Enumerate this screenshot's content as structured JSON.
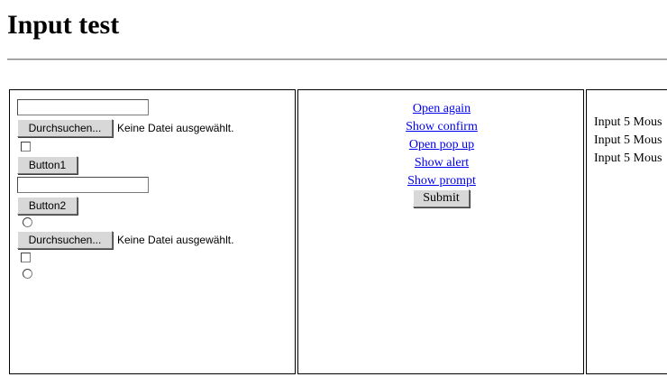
{
  "page": {
    "title": "Input test"
  },
  "left_frame": {
    "file_input_1": {
      "button_label": "Durchsuchen...",
      "status": "Keine Datei ausgewählt."
    },
    "button1_label": "Button1",
    "button2_label": "Button2",
    "file_input_2": {
      "button_label": "Durchsuchen...",
      "status": "Keine Datei ausgewählt."
    }
  },
  "middle_frame": {
    "links": [
      "Open again",
      "Show confirm",
      "Open pop up",
      "Show alert",
      "Show prompt"
    ],
    "submit_label": "Submit"
  },
  "right_frame": {
    "log_lines": [
      "Input 5 Mous",
      "Input 5 Mous",
      "Input 5 Mous"
    ]
  }
}
